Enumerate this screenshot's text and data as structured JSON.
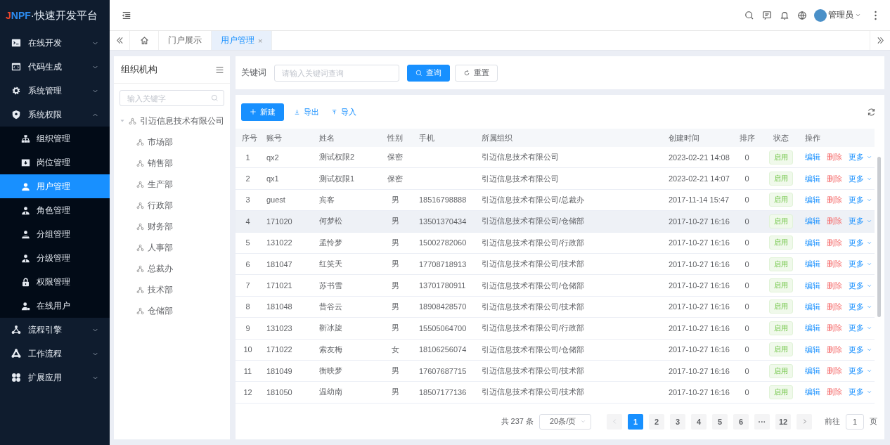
{
  "logo": {
    "mark": "JNPF",
    "name": "·快速开发平台"
  },
  "sidebar": {
    "items": [
      {
        "label": "在线开发",
        "expanded": false
      },
      {
        "label": "代码生成",
        "expanded": false
      },
      {
        "label": "系统管理",
        "expanded": false
      },
      {
        "label": "系统权限",
        "expanded": true,
        "children": [
          {
            "label": "组织管理",
            "selected": false
          },
          {
            "label": "岗位管理",
            "selected": false
          },
          {
            "label": "用户管理",
            "selected": true
          },
          {
            "label": "角色管理",
            "selected": false
          },
          {
            "label": "分组管理",
            "selected": false
          },
          {
            "label": "分级管理",
            "selected": false
          },
          {
            "label": "权限管理",
            "selected": false
          },
          {
            "label": "在线用户",
            "selected": false
          }
        ]
      },
      {
        "label": "流程引擎",
        "expanded": false
      },
      {
        "label": "工作流程",
        "expanded": false
      },
      {
        "label": "扩展应用",
        "expanded": false
      }
    ]
  },
  "header": {
    "user": "管理员"
  },
  "tabs": [
    {
      "kind": "home",
      "selected": false
    },
    {
      "kind": "page",
      "label": "门户展示",
      "selected": false
    },
    {
      "kind": "page",
      "label": "用户管理",
      "selected": true,
      "close": "×"
    }
  ],
  "org_panel": {
    "title": "组织机构",
    "search": {
      "placeholder": "输入关键字"
    },
    "tree": [
      {
        "label": "引迈信息技术有限公司",
        "expanded": true,
        "children": [
          {
            "label": "市场部"
          },
          {
            "label": "销售部"
          },
          {
            "label": "生产部"
          },
          {
            "label": "行政部"
          },
          {
            "label": "财务部"
          },
          {
            "label": "人事部"
          },
          {
            "label": "总裁办"
          },
          {
            "label": "技术部"
          },
          {
            "label": "仓储部"
          }
        ]
      }
    ]
  },
  "search": {
    "label": "关键词",
    "placeholder": "请输入关键词查询",
    "buttons": [
      {
        "label": "查询",
        "kind": "primary"
      },
      {
        "label": "重置",
        "kind": "default"
      }
    ]
  },
  "toolbar": {
    "buttons": [
      {
        "label": "新建",
        "kind": "primary"
      },
      {
        "label": "导出",
        "kind": "export"
      },
      {
        "label": "导入",
        "kind": "import"
      }
    ]
  },
  "table": {
    "columns": [
      "序号",
      "账号",
      "姓名",
      "性别",
      "手机",
      "所属组织",
      "创建时间",
      "排序",
      "状态",
      "操作"
    ],
    "rows": [
      {
        "no": "1",
        "account": "qx2",
        "name": "测试权限2",
        "gender": "保密",
        "org": "引迈信息技术有限公司",
        "created": "2023-02-21 14:08",
        "sort": "0",
        "status": "启用",
        "actions": [
          "编辑",
          "删除",
          "更多"
        ],
        "hovered": false
      },
      {
        "no": "2",
        "account": "qx1",
        "name": "测试权限1",
        "gender": "保密",
        "org": "引迈信息技术有限公司",
        "created": "2023-02-21 14:07",
        "sort": "0",
        "status": "启用",
        "actions": [
          "编辑",
          "删除",
          "更多"
        ],
        "hovered": false
      },
      {
        "no": "3",
        "account": "guest",
        "name": "宾客",
        "gender": "男",
        "phone": "18516798888",
        "org": "引迈信息技术有限公司/总裁办",
        "created": "2017-11-14 15:47",
        "sort": "0",
        "status": "启用",
        "actions": [
          "编辑",
          "删除",
          "更多"
        ],
        "hovered": false
      },
      {
        "no": "4",
        "account": "171020",
        "name": "何梦松",
        "gender": "男",
        "phone": "13501370434",
        "org": "引迈信息技术有限公司/仓储部",
        "created": "2017-10-27 16:16",
        "sort": "0",
        "status": "启用",
        "actions": [
          "编辑",
          "删除",
          "更多"
        ],
        "hovered": true
      },
      {
        "no": "5",
        "account": "131022",
        "name": "孟怜梦",
        "gender": "男",
        "phone": "15002782060",
        "org": "引迈信息技术有限公司/行政部",
        "created": "2017-10-27 16:16",
        "sort": "0",
        "status": "启用",
        "actions": [
          "编辑",
          "删除",
          "更多"
        ],
        "hovered": false
      },
      {
        "no": "6",
        "account": "181047",
        "name": "红笑天",
        "gender": "男",
        "phone": "17708718913",
        "org": "引迈信息技术有限公司/技术部",
        "created": "2017-10-27 16:16",
        "sort": "0",
        "status": "启用",
        "actions": [
          "编辑",
          "删除",
          "更多"
        ],
        "hovered": false
      },
      {
        "no": "7",
        "account": "171021",
        "name": "苏书雪",
        "gender": "男",
        "phone": "13701780911",
        "org": "引迈信息技术有限公司/仓储部",
        "created": "2017-10-27 16:16",
        "sort": "0",
        "status": "启用",
        "actions": [
          "编辑",
          "删除",
          "更多"
        ],
        "hovered": false
      },
      {
        "no": "8",
        "account": "181048",
        "name": "昔谷云",
        "gender": "男",
        "phone": "18908428570",
        "org": "引迈信息技术有限公司/技术部",
        "created": "2017-10-27 16:16",
        "sort": "0",
        "status": "启用",
        "actions": [
          "编辑",
          "删除",
          "更多"
        ],
        "hovered": false
      },
      {
        "no": "9",
        "account": "131023",
        "name": "靳冰旋",
        "gender": "男",
        "phone": "15505064700",
        "org": "引迈信息技术有限公司/行政部",
        "created": "2017-10-27 16:16",
        "sort": "0",
        "status": "启用",
        "actions": [
          "编辑",
          "删除",
          "更多"
        ],
        "hovered": false
      },
      {
        "no": "10",
        "account": "171022",
        "name": "索友梅",
        "gender": "女",
        "phone": "18106256074",
        "org": "引迈信息技术有限公司/仓储部",
        "created": "2017-10-27 16:16",
        "sort": "0",
        "status": "启用",
        "actions": [
          "编辑",
          "删除",
          "更多"
        ],
        "hovered": false
      },
      {
        "no": "11",
        "account": "181049",
        "name": "衡映梦",
        "gender": "男",
        "phone": "17607687715",
        "org": "引迈信息技术有限公司/技术部",
        "created": "2017-10-27 16:16",
        "sort": "0",
        "status": "启用",
        "actions": [
          "编辑",
          "删除",
          "更多"
        ],
        "hovered": false
      },
      {
        "no": "12",
        "account": "181050",
        "name": "温幼南",
        "gender": "男",
        "phone": "18507177136",
        "org": "引迈信息技术有限公司/技术部",
        "created": "2017-10-27 16:16",
        "sort": "0",
        "status": "启用",
        "actions": [
          "编辑",
          "删除",
          "更多"
        ],
        "hovered": false
      }
    ]
  },
  "pagination": {
    "total": "共 237 条",
    "page_size": "20条/页",
    "pages": [
      {
        "label": "1",
        "selected": true
      },
      {
        "label": "2",
        "selected": false
      },
      {
        "label": "3",
        "selected": false
      },
      {
        "label": "4",
        "selected": false
      },
      {
        "label": "5",
        "selected": false
      },
      {
        "label": "6",
        "selected": false
      },
      {
        "label": "···",
        "selected": false
      },
      {
        "label": "12",
        "selected": false
      }
    ],
    "goto_label": "前往",
    "goto_value": "1",
    "goto_suffix": "页"
  }
}
